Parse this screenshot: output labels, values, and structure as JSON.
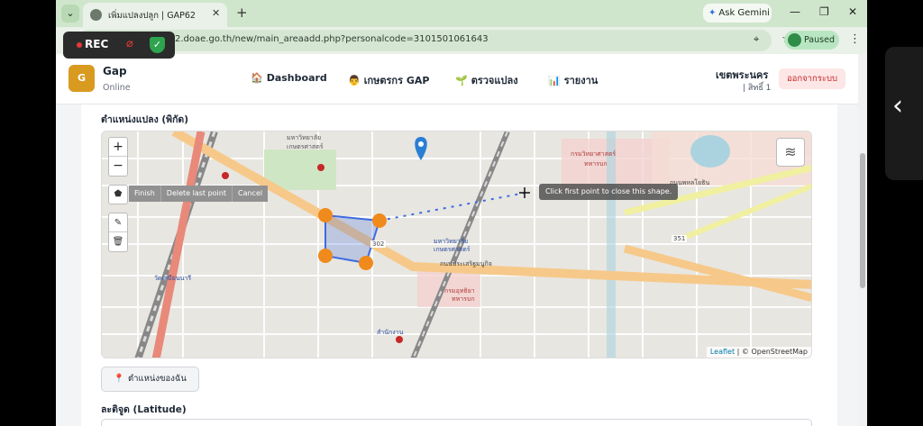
{
  "browser": {
    "tab_title": "เพิ่มแปลงปลูก | GAP62",
    "url": "2.doae.go.th/new/main_areaadd.php?personalcode=3101501061643",
    "ask_gemini": "Ask Gemini",
    "profile_status": "Paused"
  },
  "recorder": {
    "label": "REC"
  },
  "app": {
    "logo_letter": "G",
    "brand": "Gap",
    "status": "Online",
    "nav": [
      {
        "label": "Dashboard"
      },
      {
        "label": "เกษตรกร GAP"
      },
      {
        "label": "ตรวจแปลง"
      },
      {
        "label": "รายงาน"
      }
    ],
    "user_district": "เขตพระนคร",
    "user_role": "| สิทธิ์ 1",
    "logout_label": "ออกจากระบบ"
  },
  "form": {
    "location_section_label": "ตำแหน่งแปลง (พิกัด)",
    "my_location_button": "ตำแหน่งของฉัน",
    "latitude_label": "ละติจูด (Latitude)",
    "latitude_value": ""
  },
  "map": {
    "zoom_in": "+",
    "zoom_out": "−",
    "draw_actions": [
      "Finish",
      "Delete last point",
      "Cancel"
    ],
    "tooltip": "Click first point to close this shape.",
    "attribution_leaflet": "Leaflet",
    "attribution_osm": "| © OpenStreetMap",
    "labels": [
      {
        "text": "มหาวิทยาลัย"
      },
      {
        "text": "เกษตรศาสตร์"
      },
      {
        "text": "กรมวิทยาศาสตร์"
      },
      {
        "text": "ทหารบก"
      },
      {
        "text": "ถนนพหลโยธิน"
      },
      {
        "text": "ถนนประเสริฐมนูกิจ"
      },
      {
        "text": "302"
      },
      {
        "text": "351"
      },
      {
        "text": "มหาวิทยาลัย"
      },
      {
        "text": "เกษตรศาสตร์"
      },
      {
        "text": "กรมอุทธิยา"
      },
      {
        "text": "ทหารบก"
      },
      {
        "text": "วัดเสมียนนารี"
      },
      {
        "text": "สำนักงาน"
      }
    ],
    "colors": {
      "vertex": "#f08a1c",
      "polygon": "#3e6be0",
      "marker": "#2a7fd4"
    }
  }
}
